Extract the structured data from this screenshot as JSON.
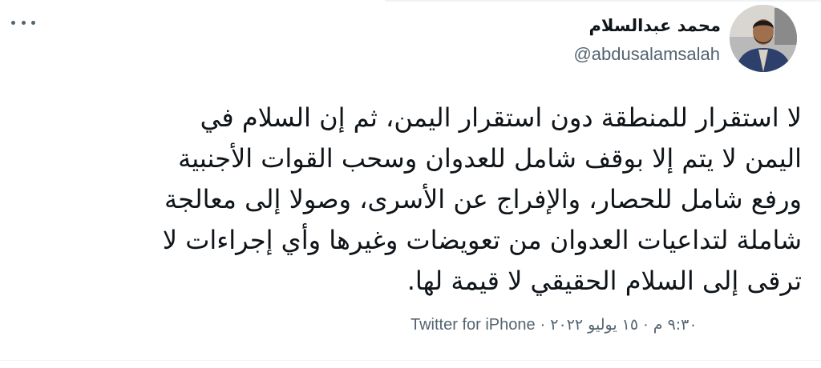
{
  "tweet": {
    "author": {
      "display_name": "محمد عبدالسلام",
      "handle": "@abdusalamsalah",
      "avatar_icon": "user-avatar"
    },
    "more_icon": "more-horizontal-icon",
    "text_lines": [
      "لا استقرار للمنطقة دون استقرار اليمن، ثم إن السلام في",
      "اليمن لا يتم إلا بوقف شامل للعدوان وسحب القوات الأجنبية",
      "ورفع شامل للحصار، والإفراج عن الأسرى، وصولا إلى معالجة",
      "شاملة لتداعيات العدوان من تعويضات وغيرها وأي إجراءات لا",
      "ترقى إلى السلام الحقيقي لا قيمة لها."
    ],
    "meta": {
      "time": "٩:٣٠ م",
      "date": "١٥ يوليو ٢٠٢٢",
      "separator": "·",
      "source": "Twitter for iPhone"
    }
  },
  "colors": {
    "text": "#0f1419",
    "secondary": "#536471",
    "divider": "#eff3f4"
  }
}
